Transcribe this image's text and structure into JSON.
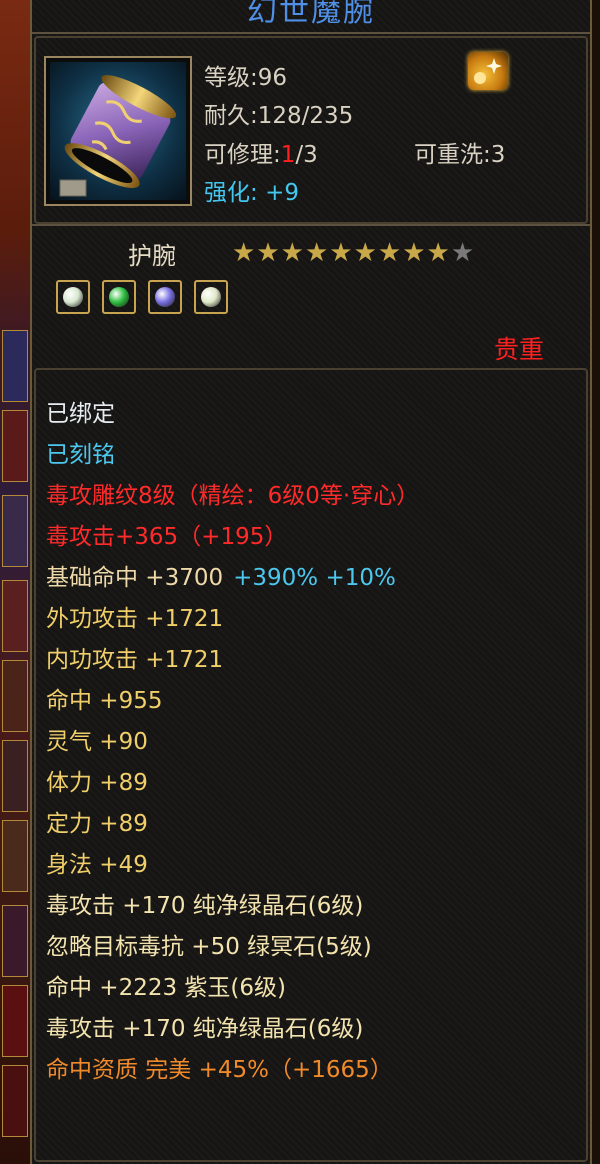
{
  "item": {
    "name": "幻世魔腕",
    "level_label": "等级:96",
    "durability_label": "耐久:128/235",
    "repair_prefix": "可修理:",
    "repair_current": "1",
    "repair_suffix": "/3",
    "rewash_label": "可重洗:3",
    "enhance_label": "强化:",
    "enhance_value": "+9",
    "type": "护腕",
    "stars_filled": 9,
    "stars_total": 10,
    "rarity": "贵重"
  },
  "colors": {
    "title": "#4f8fe6",
    "bound": "#e6ecf0",
    "engraved": "#4cc8ee",
    "red_attr": "#ff2a2a",
    "gold_attr": "#f0cf6a",
    "orange_attr": "#f08a2a",
    "rarity": "#ff2020"
  },
  "gems": [
    {
      "icon": "white-gem-icon",
      "color": "#d8e8d0"
    },
    {
      "icon": "green-gem-icon",
      "color": "#2fc040"
    },
    {
      "icon": "purple-gem-icon",
      "color": "#7a70e0"
    },
    {
      "icon": "white-gem-icon",
      "color": "#e0e8c8"
    }
  ],
  "attributes": [
    {
      "text": "已绑定",
      "color_class": "c-white"
    },
    {
      "text": "已刻铭",
      "color_class": "c-cyan"
    },
    {
      "text": "毒攻雕纹8级（精绘：6级0等·穿心）",
      "color_class": "c-red"
    },
    {
      "text": "毒攻击+365（+195）",
      "color_class": "c-red"
    },
    {
      "text": "基础命中 +3700",
      "color_class": "c-tan",
      "extra": "+390% +10%"
    },
    {
      "text": "外功攻击 +1721",
      "color_class": "c-gold"
    },
    {
      "text": "内功攻击 +1721",
      "color_class": "c-gold"
    },
    {
      "text": "命中 +955",
      "color_class": "c-gold"
    },
    {
      "text": "灵气 +90",
      "color_class": "c-gold"
    },
    {
      "text": "体力 +89",
      "color_class": "c-gold"
    },
    {
      "text": "定力 +89",
      "color_class": "c-gold"
    },
    {
      "text": "身法 +49",
      "color_class": "c-gold"
    },
    {
      "text": "毒攻击 +170 纯净绿晶石(6级)",
      "color_class": "c-paleyel"
    },
    {
      "text": "忽略目标毒抗 +50 绿冥石(5级)",
      "color_class": "c-paleyel"
    },
    {
      "text": "命中 +2223 紫玉(6级)",
      "color_class": "c-paleyel"
    },
    {
      "text": "毒攻击 +170 纯净绿晶石(6级)",
      "color_class": "c-paleyel"
    },
    {
      "text": "命中资质  完美 +45%（+1665）",
      "color_class": "c-orange"
    }
  ]
}
